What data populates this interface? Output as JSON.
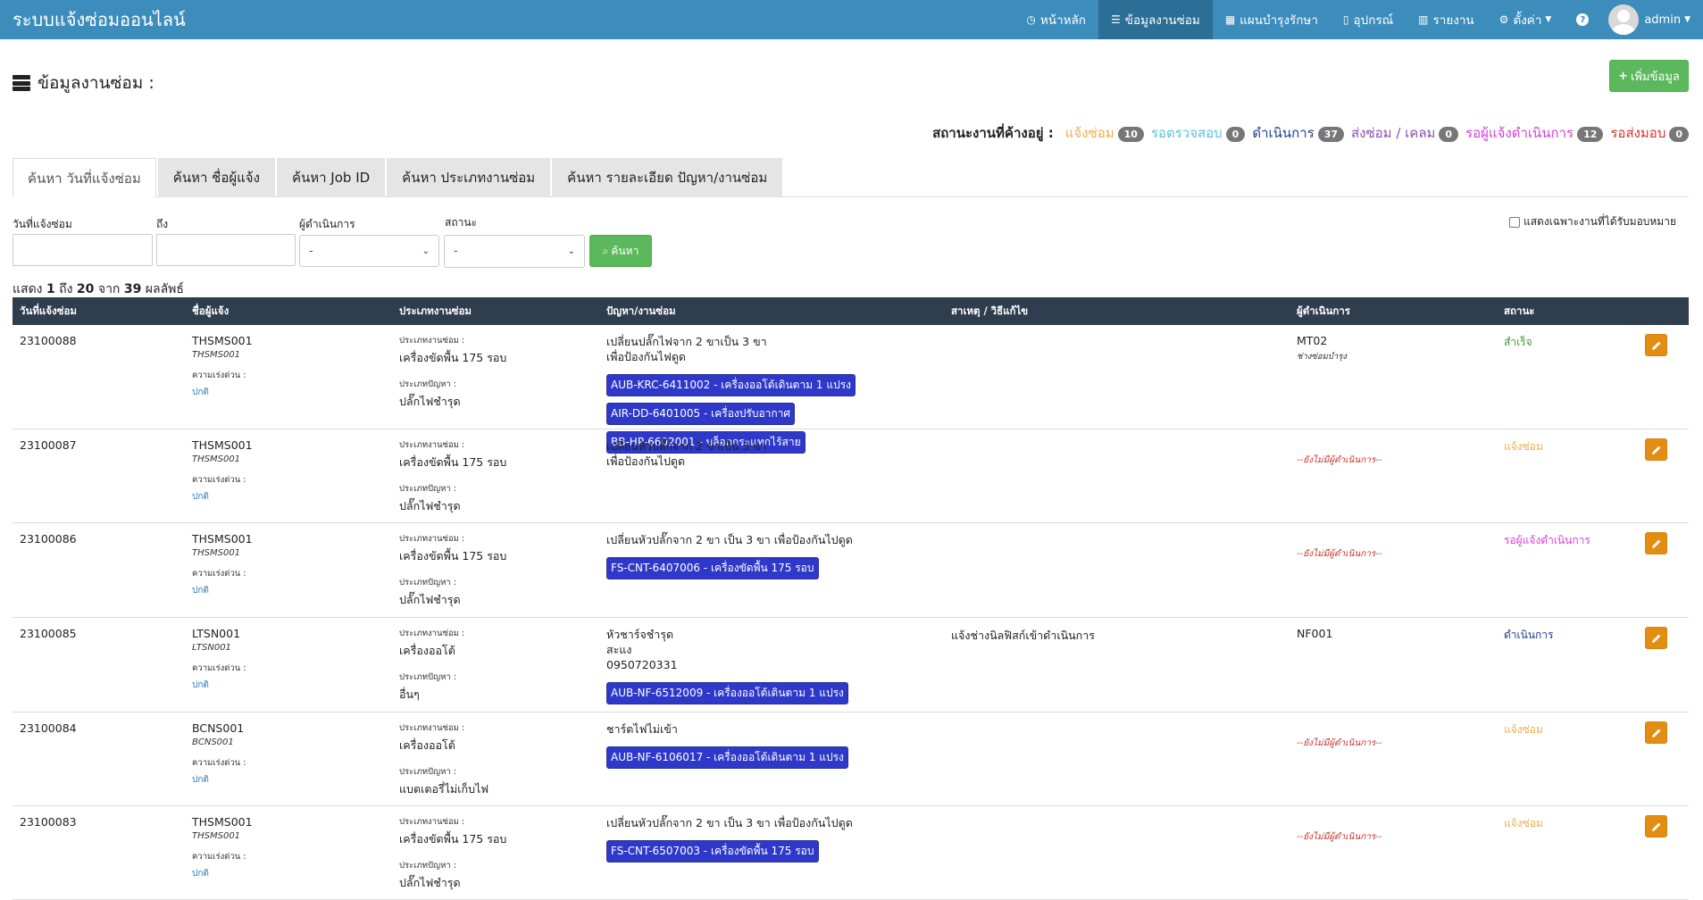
{
  "app": {
    "title": "ระบบแจ้งซ่อมออนไลน์"
  },
  "nav": {
    "home": "หน้าหลัก",
    "repair_data": "ข้อมูลงานซ่อม",
    "maintenance_plan": "แผนบำรุงรักษา",
    "devices": "อุปกรณ์",
    "reports": "รายงาน",
    "settings": "ตั้งค่า",
    "user": "admin"
  },
  "page": {
    "title": "ข้อมูลงานซ่อม :",
    "add_button": "เพิ่มข้อมูล"
  },
  "status_summary": {
    "label": "สถานะงานที่ค้างอยู่ :",
    "items": [
      {
        "label": "แจ้งซ่อม",
        "count": "10",
        "color": "#f0ad4e"
      },
      {
        "label": "รอตรวจสอบ",
        "count": "0",
        "color": "#5bc0de"
      },
      {
        "label": "ดำเนินการ",
        "count": "37",
        "color": "#1f3f8f"
      },
      {
        "label": "ส่งซ่อม / เคลม",
        "count": "0",
        "color": "#8a4fb5"
      },
      {
        "label": "รอผู้แจ้งดำเนินการ",
        "count": "12",
        "color": "#d63fd6"
      },
      {
        "label": "รอส่งมอบ",
        "count": "0",
        "color": "#d9302c"
      }
    ]
  },
  "tabs": [
    "ค้นหา วันที่แจ้งซ่อม",
    "ค้นหา ชื่อผู้แจ้ง",
    "ค้นหา Job ID",
    "ค้นหา ประเภทงานซ่อม",
    "ค้นหา รายละเอียด ปัญหา/งานซ่อม"
  ],
  "filters": {
    "date_from_label": "วันที่แจ้งซ่อม",
    "date_to_label": "ถึง",
    "operator_label": "ผู้ดำเนินการ",
    "operator_value": "-",
    "status_label": "สถานะ",
    "status_value": "-",
    "search_button": "ค้นหา",
    "assigned_only_label": "แสดงเฉพาะงานที่ได้รับมอบหมาย"
  },
  "results": {
    "prefix": "แสดง",
    "from": "1",
    "to_word": "ถึง",
    "to": "20",
    "of_word": "จาก",
    "total": "39",
    "suffix": "ผลลัพธ์"
  },
  "table": {
    "headers": [
      "วันที่แจ้งซ่อม",
      "ชื่อผู้แจ้ง",
      "ประเภทงานซ่อม",
      "ปัญหา/งานซ่อม",
      "สาเหตุ / วิธีแก้ไข",
      "ผู้ดำเนินการ",
      "สถานะ"
    ],
    "urgency_label": "ความเร่งด่วน :",
    "repair_type_label": "ประเภทงานซ่อม :",
    "problem_type_label": "ประเภทปัญหา :",
    "no_operator": "--ยังไม่มีผู้ดำเนินการ--",
    "rows": [
      {
        "job_id": "23100088",
        "reporter": "THSMS001",
        "reporter_sub": "THSMS001",
        "urgency": "ปกติ",
        "repair_type": "เครื่องขัดพื้น 175 รอบ",
        "problem_type": "ปลั๊กไฟชำรุด",
        "problem": "เปลี่ยนปลั๊กไฟจาก 2 ขาเป็น 3 ขา\nเพื่อป้องกันไฟดูด",
        "assets": [
          "AUB-KRC-6411002 - เครื่องออโต้เดินตาม 1 แปรง",
          "AIR-DD-6401005 - เครื่องปรับอากาศ",
          "BB-HP-6602001 - บล็อกกระแทกไร้สาย"
        ],
        "cause": "",
        "operator": "MT02",
        "operator_sub": "ช่างซ่อมบำรุง",
        "status": "สำเร็จ",
        "status_color": "#3c9a3c",
        "height": 117
      },
      {
        "job_id": "23100087",
        "reporter": "THSMS001",
        "reporter_sub": "THSMS001",
        "urgency": "ปกติ",
        "repair_type": "เครื่องขัดพื้น 175 รอบ",
        "problem_type": "ปลั๊กไฟชำรุด",
        "problem": "เปลี่ยนหัวปลั๊กจาก 2 ขาเป็น 3 ขา\nเพื่อป้องกันไปดูด",
        "assets": [],
        "cause": "",
        "operator": "",
        "operator_sub": "",
        "status": "แจ้งซ่อม",
        "status_color": "#f0ad4e",
        "height": 105
      },
      {
        "job_id": "23100086",
        "reporter": "THSMS001",
        "reporter_sub": "THSMS001",
        "urgency": "ปกติ",
        "repair_type": "เครื่องขัดพื้น 175 รอบ",
        "problem_type": "ปลั๊กไฟชำรุด",
        "problem": "เปลี่ยนหัวปลั๊กจาก 2 ขา เป็น 3 ขา เพื่อป้องกันไปดูด",
        "assets": [
          "FS-CNT-6407006 - เครื่องขัดพื้น 175 รอบ"
        ],
        "cause": "",
        "operator": "",
        "operator_sub": "",
        "status": "รอผู้แจ้งดำเนินการ",
        "status_color": "#d63fd6",
        "height": 106
      },
      {
        "job_id": "23100085",
        "reporter": "LTSN001",
        "reporter_sub": "LTSN001",
        "urgency": "ปกติ",
        "repair_type": "เครื่องออโต้",
        "problem_type": "อื่นๆ",
        "problem": "หัวชาร์จชำรุด\nสะแง\n0950720331",
        "assets": [
          "AUB-NF-6512009 - เครื่องออโต้เดินตาม 1 แปรง"
        ],
        "cause": "แจ้งช่างนิลฟิสก์เข้าดำเนินการ",
        "operator": "NF001",
        "operator_sub": "",
        "status": "ดำเนินการ",
        "status_color": "#1f3f8f",
        "height": 106
      },
      {
        "job_id": "23100084",
        "reporter": "BCNS001",
        "reporter_sub": "BCNS001",
        "urgency": "ปกติ",
        "repair_type": "เครื่องออโต้",
        "problem_type": "แบตเตอรี่ไม่เก็บไฟ",
        "problem": "ชาร์ตไฟไม่เข้า",
        "assets": [
          "AUB-NF-6106017 - เครื่องออโต้เดินตาม 1 แปรง"
        ],
        "cause": "",
        "operator": "",
        "operator_sub": "",
        "status": "แจ้งซ่อม",
        "status_color": "#f0ad4e",
        "height": 105
      },
      {
        "job_id": "23100083",
        "reporter": "THSMS001",
        "reporter_sub": "THSMS001",
        "urgency": "ปกติ",
        "repair_type": "เครื่องขัดพื้น 175 รอบ",
        "problem_type": "ปลั๊กไฟชำรุด",
        "problem": "เปลี่ยนหัวปลั๊กจาก 2 ขา เป็น 3 ขา เพื่อป้องกันไปดูด",
        "assets": [
          "FS-CNT-6507003 - เครื่องขัดพื้น 175 รอบ"
        ],
        "cause": "",
        "operator": "",
        "operator_sub": "",
        "status": "แจ้งซ่อม",
        "status_color": "#f0ad4e",
        "height": 105
      }
    ]
  }
}
